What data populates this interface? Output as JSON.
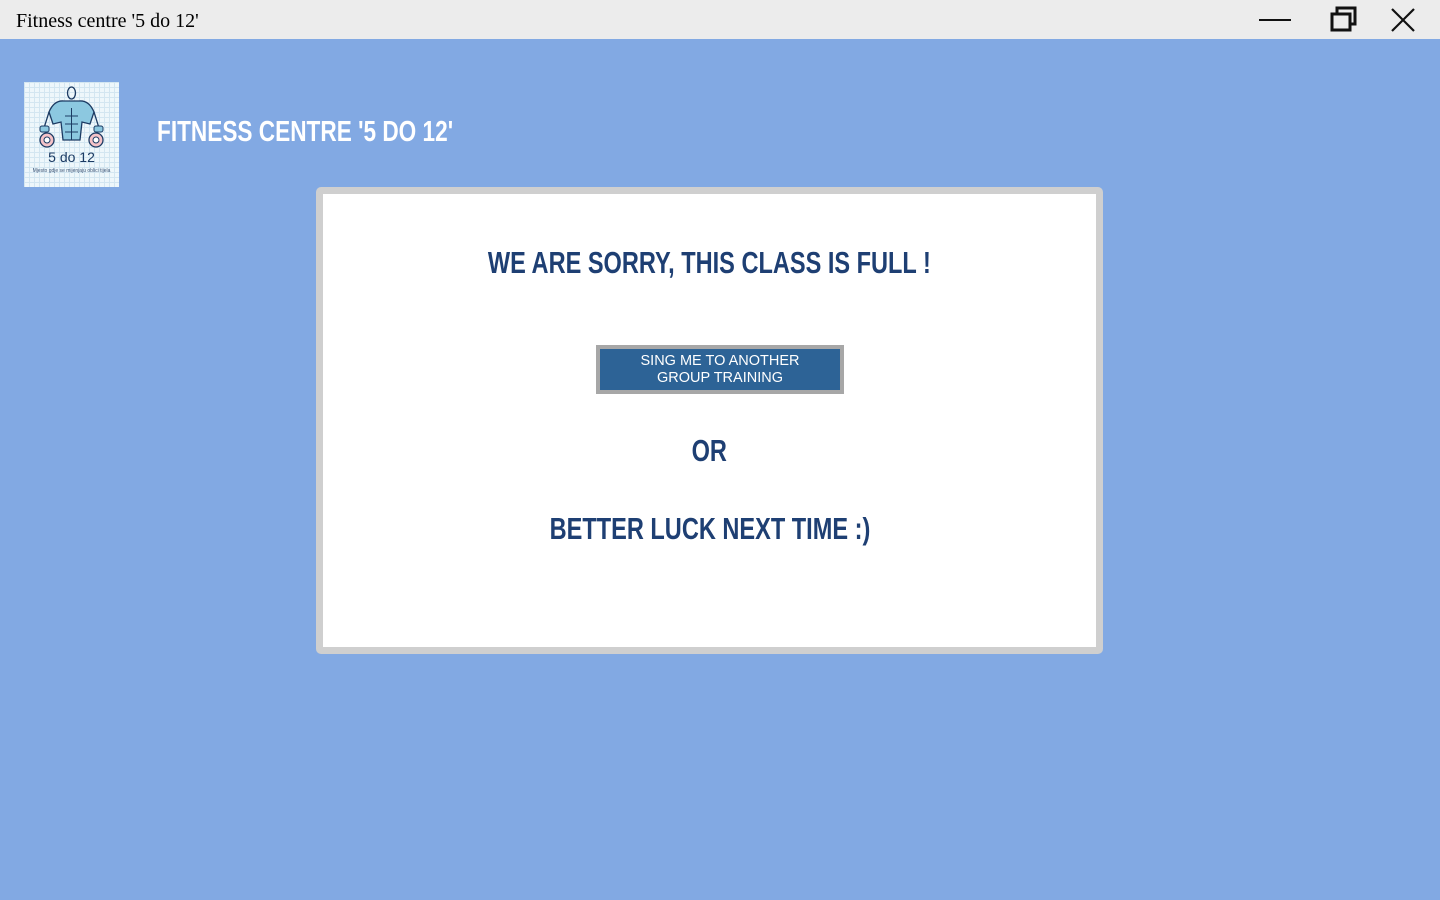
{
  "window": {
    "title": "Fitness centre '5 do 12'",
    "controls": {
      "minimize": "minimize-icon",
      "restore": "restore-icon",
      "close": "close-icon"
    }
  },
  "header": {
    "logo": {
      "text": "5 do 12",
      "tagline": "Mjesto gdje se mijenjaju oblici tijela"
    },
    "title": "FITNESS CENTRE '5 DO 12'"
  },
  "dialog": {
    "heading": "WE ARE SORRY, THIS CLASS IS FULL !",
    "button_line1": "SING ME TO ANOTHER",
    "button_line2": "GROUP TRAINING",
    "or_text": "OR",
    "closing": "BETTER LUCK NEXT TIME :)"
  },
  "colors": {
    "background": "#82a9e3",
    "titlebar": "#ececec",
    "heading_text": "#1e3f73",
    "button_fill": "#2d6396",
    "button_border": "#a7a7a7",
    "dialog_border": "#cfcfcf"
  }
}
